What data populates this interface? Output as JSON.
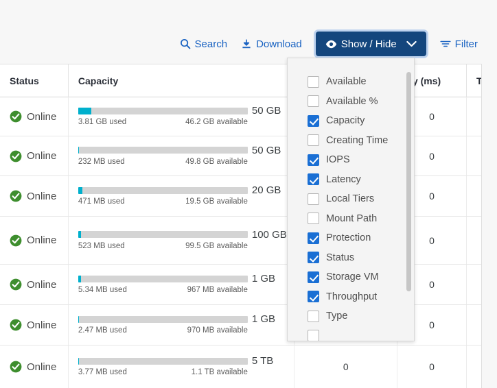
{
  "toolbar": {
    "search": {
      "label": "Search",
      "icon": "search-icon"
    },
    "download": {
      "label": "Download",
      "icon": "download-icon"
    },
    "show_hide": {
      "label": "Show / Hide",
      "icon": "eye-icon",
      "chevron": "chevron-down-icon",
      "active": true
    },
    "filter": {
      "label": "Filter",
      "icon": "filter-icon"
    },
    "accent_color": "#14467d",
    "link_color": "#1a63c2"
  },
  "show_hide_menu": {
    "open": true,
    "scrollbar_visible": true,
    "items": [
      {
        "label": "Available",
        "checked": false
      },
      {
        "label": "Available %",
        "checked": false
      },
      {
        "label": "Capacity",
        "checked": true
      },
      {
        "label": "Creating Time",
        "checked": false
      },
      {
        "label": "IOPS",
        "checked": true
      },
      {
        "label": "Latency",
        "checked": true
      },
      {
        "label": "Local Tiers",
        "checked": false
      },
      {
        "label": "Mount Path",
        "checked": false
      },
      {
        "label": "Protection",
        "checked": true
      },
      {
        "label": "Status",
        "checked": true
      },
      {
        "label": "Storage VM",
        "checked": true
      },
      {
        "label": "Throughput",
        "checked": true
      },
      {
        "label": "Type",
        "checked": false
      },
      {
        "label": "",
        "checked": false
      }
    ]
  },
  "table": {
    "headers": {
      "status": "Status",
      "capacity": "Capacity",
      "iops": "",
      "latency_visible": "cy (ms)",
      "latency_full": "Latency (ms)",
      "latency_unit": "",
      "throughput_visible": "T"
    },
    "status_label": "Online",
    "status_color": "#3e8e2e",
    "bar_fill_color": "#00b0cd",
    "bar_track_color": "#d4d4d4",
    "rows": [
      {
        "status": "Online",
        "used": "3.81 GB used",
        "available": "46.2 GB available",
        "total": "50 GB",
        "fill_pct": 7.6,
        "iops": "",
        "latency": "0"
      },
      {
        "status": "Online",
        "used": "232 MB used",
        "available": "49.8 GB available",
        "total": "50 GB",
        "fill_pct": 0.5,
        "iops": "",
        "latency": "0"
      },
      {
        "status": "Online",
        "used": "471 MB used",
        "available": "19.5 GB available",
        "total": "20 GB",
        "fill_pct": 2.4,
        "iops": "",
        "latency": "0"
      },
      {
        "status": "Online",
        "used": "523 MB used",
        "available": "99.5 GB available",
        "total": "100 GB",
        "fill_pct": 1.6,
        "iops": "",
        "latency": "0"
      },
      {
        "status": "Online",
        "used": "5.34 MB used",
        "available": "967 MB available",
        "total": "1 GB",
        "fill_pct": 1.6,
        "iops": "",
        "latency": "0"
      },
      {
        "status": "Online",
        "used": "2.47 MB used",
        "available": "970 MB available",
        "total": "1 GB",
        "fill_pct": 0.3,
        "iops": "",
        "latency": "0"
      },
      {
        "status": "Online",
        "used": "3.77 MB used",
        "available": "1.1 TB available",
        "total": "5 TB",
        "fill_pct": 0.2,
        "iops": "0",
        "latency": "0"
      }
    ]
  }
}
